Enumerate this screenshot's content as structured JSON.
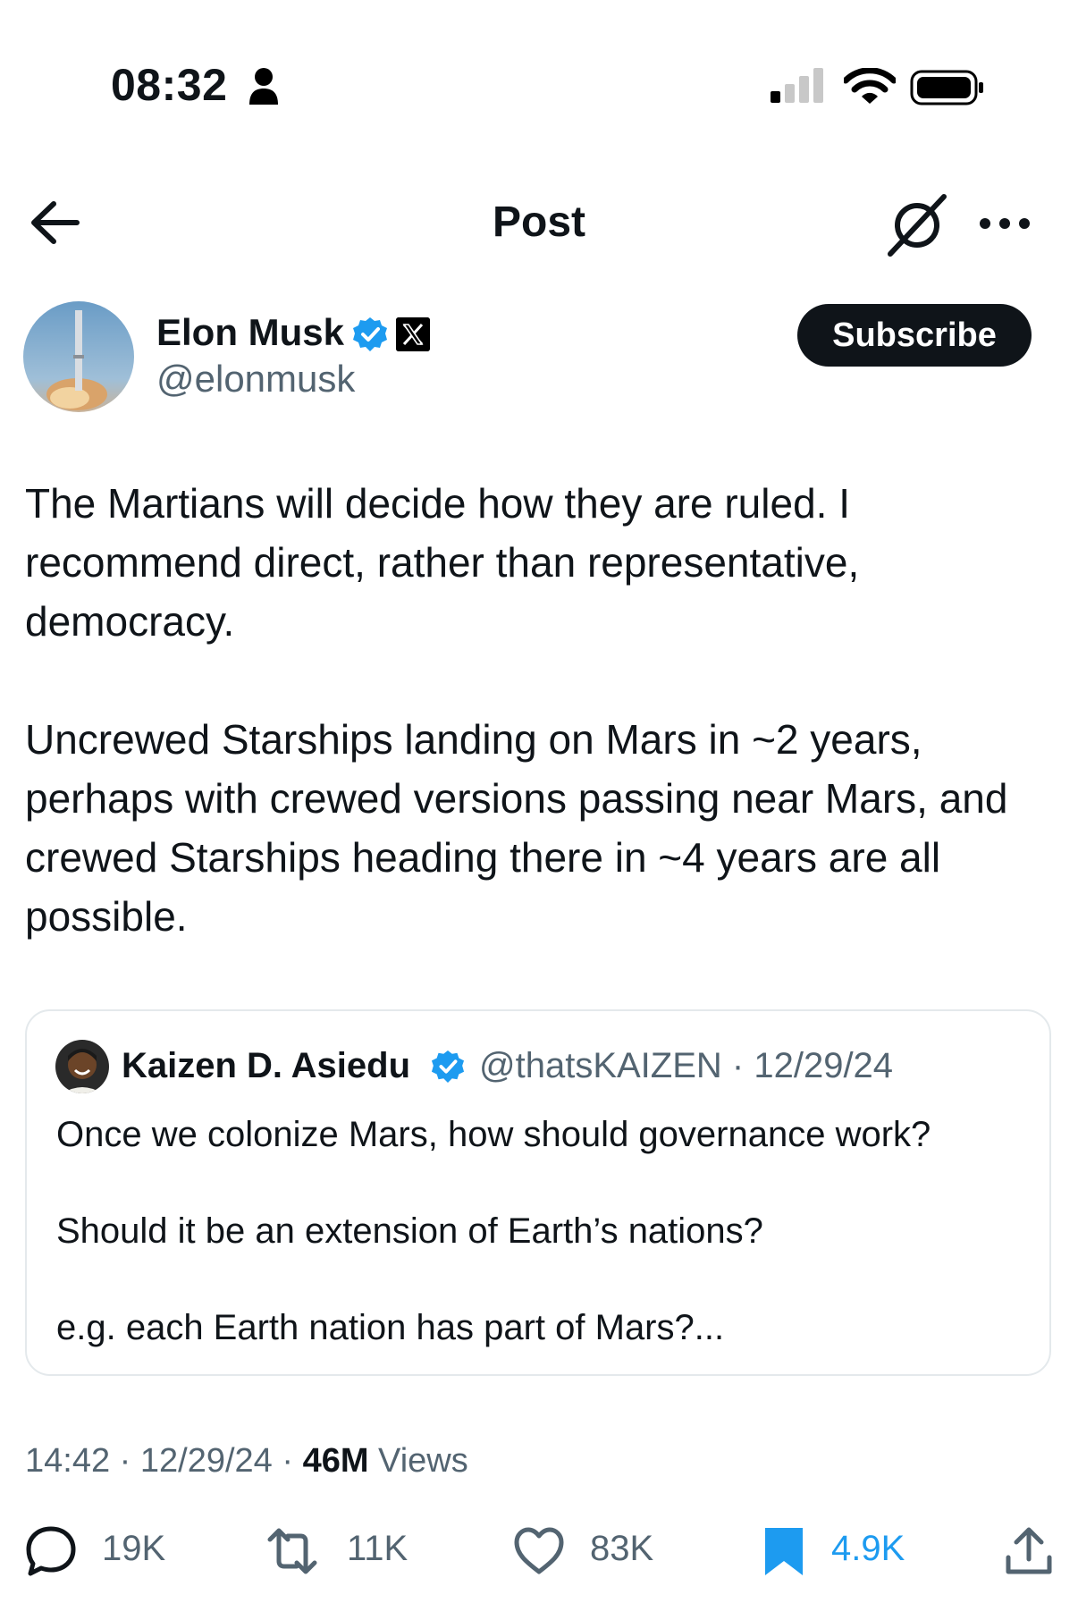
{
  "status_bar": {
    "time": "08:32",
    "icons": [
      "person-icon",
      "signal-icon",
      "wifi-icon",
      "battery-icon"
    ]
  },
  "nav": {
    "title": "Post",
    "icons": [
      "back-arrow-icon",
      "grok-icon",
      "more-icon"
    ]
  },
  "author": {
    "name": "Elon Musk",
    "handle": "@elonmusk",
    "subscribe_label": "Subscribe",
    "verified_color": "#1d9bf0"
  },
  "post": {
    "paragraphs": [
      "The Martians will decide how they are ruled. I recommend direct, rather than representative, democracy.",
      "Uncrewed Starships landing on Mars in ~2 years, perhaps with crewed versions passing near Mars, and crewed Starships heading there in ~4 years are all possible."
    ]
  },
  "quote": {
    "name": "Kaizen D. Asiedu",
    "handle_date": "@thatsKAIZEN · 12/29/24",
    "paragraphs": [
      "Once we colonize Mars, how should governance work?",
      "Should it be an extension of Earth’s nations?",
      "e.g. each Earth nation has part of Mars?..."
    ]
  },
  "meta": {
    "time_date": "14:42 · 12/29/24 · ",
    "views_count": "46M",
    "views_label": " Views"
  },
  "actions": {
    "replies": "19K",
    "reposts": "11K",
    "likes": "83K",
    "bookmarks": "4.9K",
    "bookmark_color": "#1d9bf0"
  }
}
